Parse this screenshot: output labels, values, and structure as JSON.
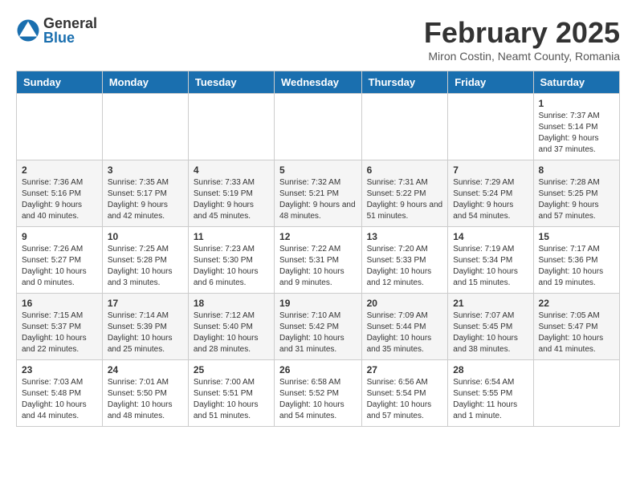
{
  "header": {
    "logo_general": "General",
    "logo_blue": "Blue",
    "month_year": "February 2025",
    "location": "Miron Costin, Neamt County, Romania"
  },
  "weekdays": [
    "Sunday",
    "Monday",
    "Tuesday",
    "Wednesday",
    "Thursday",
    "Friday",
    "Saturday"
  ],
  "weeks": [
    [
      {
        "day": "",
        "info": ""
      },
      {
        "day": "",
        "info": ""
      },
      {
        "day": "",
        "info": ""
      },
      {
        "day": "",
        "info": ""
      },
      {
        "day": "",
        "info": ""
      },
      {
        "day": "",
        "info": ""
      },
      {
        "day": "1",
        "info": "Sunrise: 7:37 AM\nSunset: 5:14 PM\nDaylight: 9 hours and 37 minutes."
      }
    ],
    [
      {
        "day": "2",
        "info": "Sunrise: 7:36 AM\nSunset: 5:16 PM\nDaylight: 9 hours and 40 minutes."
      },
      {
        "day": "3",
        "info": "Sunrise: 7:35 AM\nSunset: 5:17 PM\nDaylight: 9 hours and 42 minutes."
      },
      {
        "day": "4",
        "info": "Sunrise: 7:33 AM\nSunset: 5:19 PM\nDaylight: 9 hours and 45 minutes."
      },
      {
        "day": "5",
        "info": "Sunrise: 7:32 AM\nSunset: 5:21 PM\nDaylight: 9 hours and 48 minutes."
      },
      {
        "day": "6",
        "info": "Sunrise: 7:31 AM\nSunset: 5:22 PM\nDaylight: 9 hours and 51 minutes."
      },
      {
        "day": "7",
        "info": "Sunrise: 7:29 AM\nSunset: 5:24 PM\nDaylight: 9 hours and 54 minutes."
      },
      {
        "day": "8",
        "info": "Sunrise: 7:28 AM\nSunset: 5:25 PM\nDaylight: 9 hours and 57 minutes."
      }
    ],
    [
      {
        "day": "9",
        "info": "Sunrise: 7:26 AM\nSunset: 5:27 PM\nDaylight: 10 hours and 0 minutes."
      },
      {
        "day": "10",
        "info": "Sunrise: 7:25 AM\nSunset: 5:28 PM\nDaylight: 10 hours and 3 minutes."
      },
      {
        "day": "11",
        "info": "Sunrise: 7:23 AM\nSunset: 5:30 PM\nDaylight: 10 hours and 6 minutes."
      },
      {
        "day": "12",
        "info": "Sunrise: 7:22 AM\nSunset: 5:31 PM\nDaylight: 10 hours and 9 minutes."
      },
      {
        "day": "13",
        "info": "Sunrise: 7:20 AM\nSunset: 5:33 PM\nDaylight: 10 hours and 12 minutes."
      },
      {
        "day": "14",
        "info": "Sunrise: 7:19 AM\nSunset: 5:34 PM\nDaylight: 10 hours and 15 minutes."
      },
      {
        "day": "15",
        "info": "Sunrise: 7:17 AM\nSunset: 5:36 PM\nDaylight: 10 hours and 19 minutes."
      }
    ],
    [
      {
        "day": "16",
        "info": "Sunrise: 7:15 AM\nSunset: 5:37 PM\nDaylight: 10 hours and 22 minutes."
      },
      {
        "day": "17",
        "info": "Sunrise: 7:14 AM\nSunset: 5:39 PM\nDaylight: 10 hours and 25 minutes."
      },
      {
        "day": "18",
        "info": "Sunrise: 7:12 AM\nSunset: 5:40 PM\nDaylight: 10 hours and 28 minutes."
      },
      {
        "day": "19",
        "info": "Sunrise: 7:10 AM\nSunset: 5:42 PM\nDaylight: 10 hours and 31 minutes."
      },
      {
        "day": "20",
        "info": "Sunrise: 7:09 AM\nSunset: 5:44 PM\nDaylight: 10 hours and 35 minutes."
      },
      {
        "day": "21",
        "info": "Sunrise: 7:07 AM\nSunset: 5:45 PM\nDaylight: 10 hours and 38 minutes."
      },
      {
        "day": "22",
        "info": "Sunrise: 7:05 AM\nSunset: 5:47 PM\nDaylight: 10 hours and 41 minutes."
      }
    ],
    [
      {
        "day": "23",
        "info": "Sunrise: 7:03 AM\nSunset: 5:48 PM\nDaylight: 10 hours and 44 minutes."
      },
      {
        "day": "24",
        "info": "Sunrise: 7:01 AM\nSunset: 5:50 PM\nDaylight: 10 hours and 48 minutes."
      },
      {
        "day": "25",
        "info": "Sunrise: 7:00 AM\nSunset: 5:51 PM\nDaylight: 10 hours and 51 minutes."
      },
      {
        "day": "26",
        "info": "Sunrise: 6:58 AM\nSunset: 5:52 PM\nDaylight: 10 hours and 54 minutes."
      },
      {
        "day": "27",
        "info": "Sunrise: 6:56 AM\nSunset: 5:54 PM\nDaylight: 10 hours and 57 minutes."
      },
      {
        "day": "28",
        "info": "Sunrise: 6:54 AM\nSunset: 5:55 PM\nDaylight: 11 hours and 1 minute."
      },
      {
        "day": "",
        "info": ""
      }
    ]
  ]
}
